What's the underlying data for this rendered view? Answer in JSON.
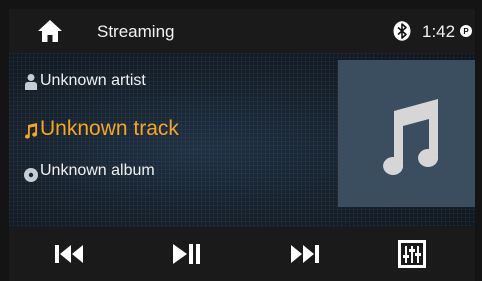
{
  "status_bar": {
    "title": "Streaming",
    "time": "1:42",
    "icons": [
      "home-icon",
      "bluetooth-icon",
      "notification-p-icon"
    ]
  },
  "now_playing": {
    "artist": "Unknown artist",
    "track": "Unknown track",
    "album": "Unknown album",
    "icons": [
      "person-icon",
      "music-note-icon",
      "disc-icon"
    ],
    "track_color": "#f5a623"
  },
  "album_art": {
    "icon": "music-note-icon"
  },
  "controls": [
    "skip-previous-icon",
    "play-pause-icon",
    "skip-next-icon",
    "equalizer-icon"
  ]
}
